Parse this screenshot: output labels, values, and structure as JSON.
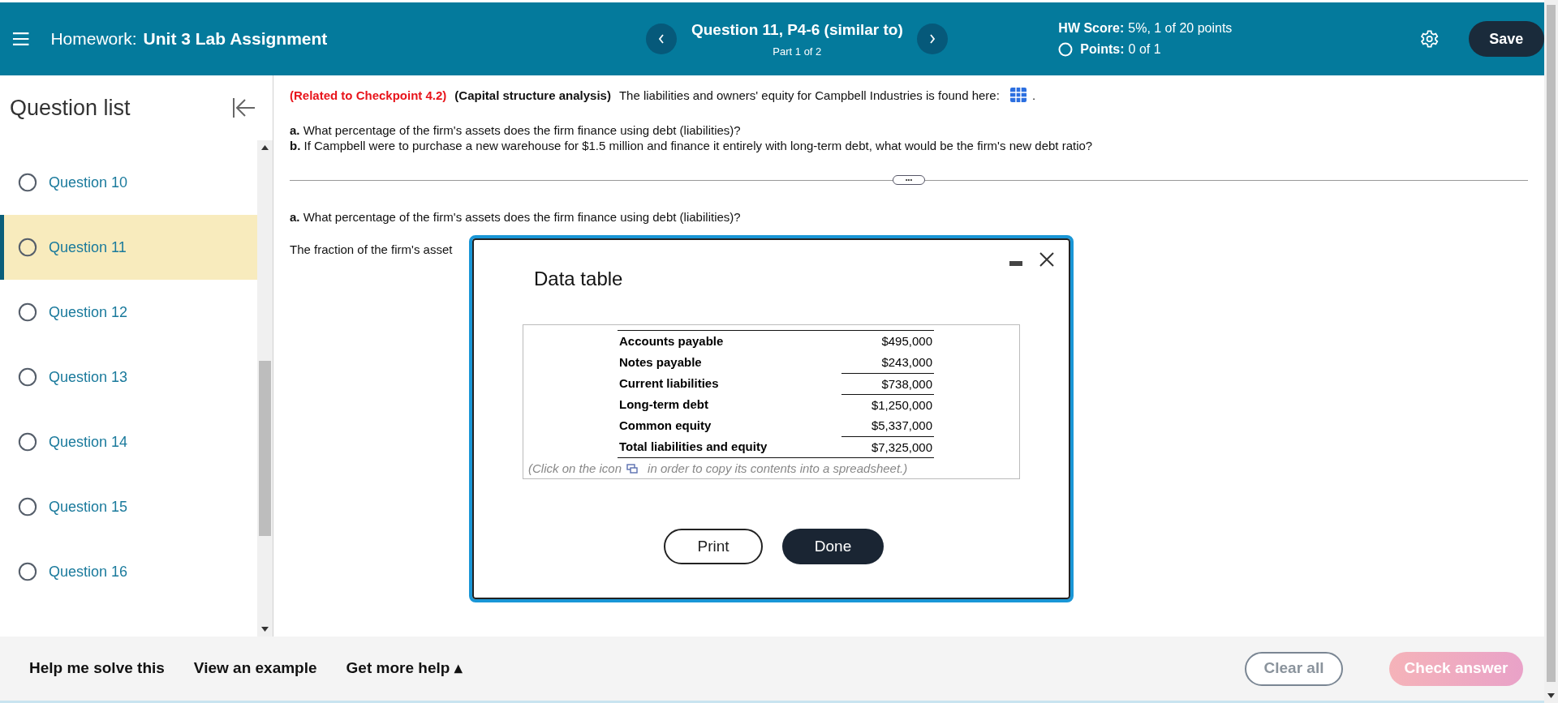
{
  "header": {
    "title_label": "Homework:",
    "title": "Unit 3 Lab Assignment",
    "question": "Question 11, P4-6 (similar to)",
    "part": "Part 1 of 2",
    "hw_score_label": "HW Score:",
    "hw_score": "5%, 1 of 20 points",
    "points_label": "Points:",
    "points": "0 of 1",
    "save": "Save"
  },
  "sidebar": {
    "title": "Question list",
    "items": [
      {
        "label": "Question 10",
        "selected": false
      },
      {
        "label": "Question 11",
        "selected": true
      },
      {
        "label": "Question 12",
        "selected": false
      },
      {
        "label": "Question 13",
        "selected": false
      },
      {
        "label": "Question 14",
        "selected": false
      },
      {
        "label": "Question 15",
        "selected": false
      },
      {
        "label": "Question 16",
        "selected": false
      }
    ]
  },
  "question": {
    "related": "(Related to Checkpoint 4.2)",
    "topic": "(Capital structure analysis)",
    "intro": "The liabilities and owners' equity for Campbell Industries is found here:",
    "intro_end": ".",
    "parts": [
      "**a.** What percentage of the firm's assets does the firm finance using debt (liabilities)?",
      "**b.** If Campbell were to purchase a new warehouse for $1.5 million and finance it entirely with long-term debt, what would be the firm's new debt ratio?"
    ],
    "expand": "•••",
    "current_part": "**a.** What percentage of the firm's assets does the firm finance using debt (liabilities)?",
    "answer_line": "The fraction of the firm's asset"
  },
  "modal": {
    "title": "Data table",
    "rows": [
      {
        "label": "Accounts payable",
        "value": "$495,000",
        "rule_above": false
      },
      {
        "label": "Notes payable",
        "value": "$243,000",
        "rule_above": false
      },
      {
        "label": "Current liabilities",
        "value": "$738,000",
        "rule_above": true
      },
      {
        "label": "Long-term debt",
        "value": "$1,250,000",
        "rule_above": true
      },
      {
        "label": "Common equity",
        "value": "$5,337,000",
        "rule_above": false
      },
      {
        "label": "Total liabilities and equity",
        "value": "$7,325,000",
        "rule_above": true
      }
    ],
    "note_before": "(Click on the icon",
    "note_after": "in order to copy its contents into a spreadsheet.)",
    "print": "Print",
    "done": "Done"
  },
  "footer": {
    "links": [
      "Help me solve this",
      "View an example",
      "Get more help ▴"
    ],
    "clear": "Clear all",
    "check": "Check answer"
  }
}
